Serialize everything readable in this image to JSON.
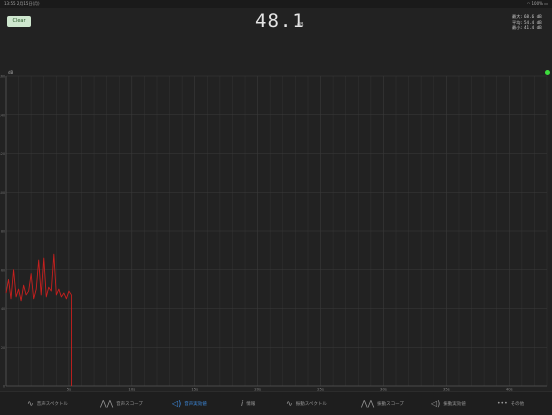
{
  "status_bar": {
    "time": "13:55",
    "date": "2月15日(月)",
    "battery": "100%"
  },
  "header": {
    "clear_label": "Clear",
    "db_value": "48.1",
    "db_unit": "dB"
  },
  "stats": [
    {
      "label": "最大:",
      "value": "68.6 dB"
    },
    {
      "label": "平均:",
      "value": "54.4 dB"
    },
    {
      "label": "最小:",
      "value": "41.4 dB"
    }
  ],
  "chart_data": {
    "type": "line",
    "ylabel": "dB",
    "ylim": [
      0,
      160
    ],
    "xlim": [
      0,
      43
    ],
    "y_ticks": [
      0,
      20,
      40,
      60,
      80,
      100,
      120,
      140,
      160
    ],
    "x_ticks": [
      "5s",
      "10s",
      "15s",
      "20s",
      "25s",
      "30s",
      "35s",
      "40s"
    ],
    "x_tick_values": [
      5,
      10,
      15,
      20,
      25,
      30,
      35,
      40
    ],
    "series": [
      {
        "color": "#c8201e",
        "x": [
          0,
          0.2,
          0.4,
          0.6,
          0.8,
          1.0,
          1.2,
          1.4,
          1.6,
          1.8,
          2.0,
          2.2,
          2.4,
          2.6,
          2.8,
          3.0,
          3.2,
          3.4,
          3.6,
          3.8,
          4.0,
          4.2,
          4.4,
          4.6,
          4.8,
          5.0,
          5.2,
          5.21
        ],
        "y": [
          48,
          55,
          45,
          60,
          46,
          50,
          44,
          52,
          47,
          49,
          58,
          45,
          50,
          65,
          47,
          66,
          46,
          51,
          49,
          68,
          47,
          50,
          46,
          48,
          45,
          49,
          47,
          0
        ]
      }
    ]
  },
  "tabs": [
    {
      "icon": "∿",
      "label": "音声スペクトル",
      "active": false
    },
    {
      "icon": "⋀⋀",
      "label": "音声スコープ",
      "active": false
    },
    {
      "icon": "◁)",
      "label": "音声実効値",
      "active": true
    },
    {
      "icon": "i",
      "label": "情報",
      "active": false
    },
    {
      "icon": "∿",
      "label": "振動スペクトル",
      "active": false
    },
    {
      "icon": "⋀⋀",
      "label": "振動スコープ",
      "active": false
    },
    {
      "icon": "◁)",
      "label": "振動実効値",
      "active": false
    },
    {
      "icon": "•••",
      "label": "その他",
      "active": false
    }
  ],
  "colors": {
    "accent": "#3f8fe6",
    "trace": "#c8201e",
    "indicator": "#3ddc3d"
  }
}
